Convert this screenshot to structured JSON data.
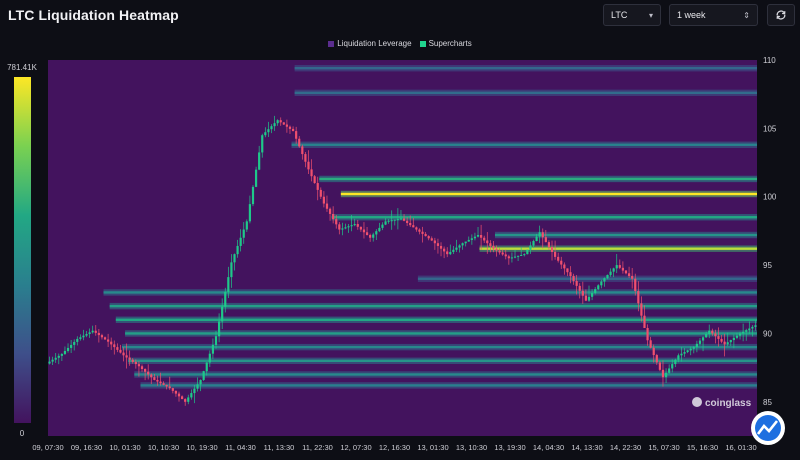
{
  "header": {
    "title": "LTC Liquidation Heatmap",
    "coin_select": "LTC",
    "range_select": "1 week",
    "refresh_icon": "refresh-icon"
  },
  "legend": {
    "items": [
      {
        "label": "Liquidation Leverage",
        "color": "#5b2d8f"
      },
      {
        "label": "Supercharts",
        "color": "#21d48f"
      }
    ]
  },
  "watermark": "coinglass",
  "colorscale": {
    "max_label": "781.41K",
    "min_label": "0",
    "stops": [
      "#43135e",
      "#3e4f8a",
      "#2a7f8e",
      "#22a884",
      "#7ad151",
      "#fde725"
    ]
  },
  "chart_data": {
    "type": "heatmap",
    "title": "LTC Liquidation Heatmap",
    "ylim": [
      82.5,
      110
    ],
    "yticks": [
      85,
      90,
      95,
      100,
      105,
      110
    ],
    "xticks": [
      "09, 07:30",
      "09, 16:30",
      "10, 01:30",
      "10, 10:30",
      "10, 19:30",
      "11, 04:30",
      "11, 13:30",
      "11, 22:30",
      "12, 07:30",
      "12, 16:30",
      "13, 01:30",
      "13, 10:30",
      "13, 19:30",
      "14, 04:30",
      "14, 13:30",
      "14, 22:30",
      "15, 07:30",
      "15, 16:30",
      "16, 01:30"
    ],
    "price_path": [
      [
        0,
        87.8
      ],
      [
        0.5,
        88.5
      ],
      [
        1,
        89.6
      ],
      [
        1.5,
        90.2
      ],
      [
        2,
        89.4
      ],
      [
        2.5,
        88.4
      ],
      [
        3,
        87.6
      ],
      [
        3.5,
        86.6
      ],
      [
        4,
        86.0
      ],
      [
        4.5,
        85.0
      ],
      [
        5,
        86.6
      ],
      [
        5.5,
        89.8
      ],
      [
        6,
        95.2
      ],
      [
        6.5,
        98.2
      ],
      [
        7,
        104.5
      ],
      [
        7.5,
        105.6
      ],
      [
        8,
        104.8
      ],
      [
        8.5,
        102.0
      ],
      [
        9,
        99.5
      ],
      [
        9.5,
        97.6
      ],
      [
        10,
        98.0
      ],
      [
        10.5,
        97.0
      ],
      [
        11,
        98.2
      ],
      [
        11.5,
        98.4
      ],
      [
        12,
        97.6
      ],
      [
        12.5,
        96.8
      ],
      [
        13,
        95.8
      ],
      [
        13.5,
        96.6
      ],
      [
        14,
        97.2
      ],
      [
        14.5,
        96.2
      ],
      [
        15,
        95.5
      ],
      [
        15.5,
        95.8
      ],
      [
        16,
        97.4
      ],
      [
        16.5,
        95.6
      ],
      [
        17,
        94.2
      ],
      [
        17.5,
        92.4
      ],
      [
        18,
        93.8
      ],
      [
        18.5,
        95.0
      ],
      [
        19,
        94.0
      ],
      [
        19.5,
        89.5
      ],
      [
        20,
        86.8
      ],
      [
        20.5,
        88.4
      ],
      [
        21,
        89.0
      ],
      [
        21.5,
        90.2
      ],
      [
        22,
        89.2
      ],
      [
        22.5,
        90.0
      ],
      [
        23,
        90.6
      ]
    ],
    "liquidation_levels": [
      {
        "price": 100.2,
        "intensity": 1.0,
        "from": 9.5
      },
      {
        "price": 96.2,
        "intensity": 0.9,
        "from": 14.0
      },
      {
        "price": 101.3,
        "intensity": 0.62,
        "from": 8.8
      },
      {
        "price": 98.5,
        "intensity": 0.6,
        "from": 9.2
      },
      {
        "price": 97.2,
        "intensity": 0.5,
        "from": 14.5
      },
      {
        "price": 103.8,
        "intensity": 0.42,
        "from": 7.9
      },
      {
        "price": 107.6,
        "intensity": 0.32,
        "from": 8.0
      },
      {
        "price": 109.4,
        "intensity": 0.3,
        "from": 8.0
      },
      {
        "price": 94.0,
        "intensity": 0.3,
        "from": 12.0
      },
      {
        "price": 92.0,
        "intensity": 0.55,
        "from": 2.0
      },
      {
        "price": 91.0,
        "intensity": 0.6,
        "from": 2.2
      },
      {
        "price": 90.0,
        "intensity": 0.55,
        "from": 2.5
      },
      {
        "price": 89.0,
        "intensity": 0.45,
        "from": 2.4
      },
      {
        "price": 88.0,
        "intensity": 0.5,
        "from": 2.6
      },
      {
        "price": 87.0,
        "intensity": 0.45,
        "from": 2.8
      },
      {
        "price": 86.2,
        "intensity": 0.4,
        "from": 3.0
      },
      {
        "price": 93.0,
        "intensity": 0.45,
        "from": 1.8
      }
    ]
  }
}
